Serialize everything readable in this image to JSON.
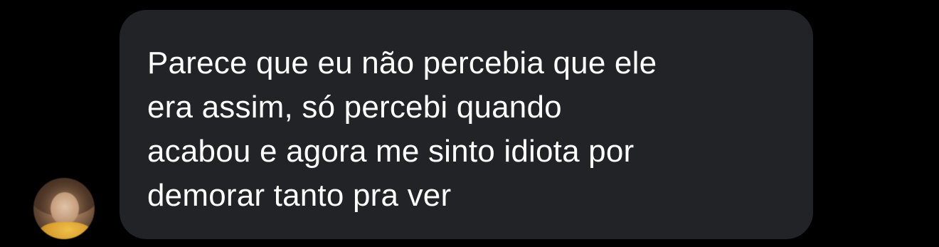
{
  "conversation": {
    "messages": [
      {
        "sender_avatar": "avatar-photo",
        "text_lines": [
          "Parece que eu não percebia que ele",
          "era assim, só percebi quando",
          "acabou e agora me sinto idiota por",
          "demorar tanto pra ver"
        ]
      }
    ]
  },
  "colors": {
    "background": "#000000",
    "bubble": "#212327",
    "text": "#ffffff"
  }
}
